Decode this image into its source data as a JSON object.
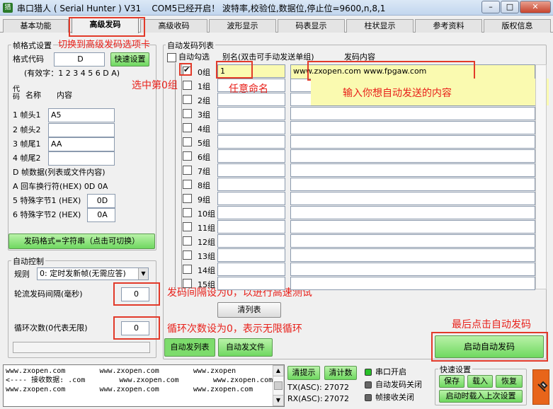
{
  "window": {
    "app_name": "串口猎人",
    "app_name_en": "( Serial Hunter ) V31",
    "status": "COM5已经开启！ 波特率,校验位,数据位,停止位=9600,n,8,1",
    "minimize": "–",
    "maximize": "□",
    "close": "✕"
  },
  "tabs": [
    "基本功能",
    "高级发码",
    "高级收码",
    "波形显示",
    "码表显示",
    "柱状显示",
    "参考资料",
    "版权信息"
  ],
  "frame_settings": {
    "title": "帧格式设置",
    "format_code_label": "格式代码",
    "format_code_value": "D",
    "quick_set_button": "快速设置",
    "valid_chars": "(有效字：1 2 3 4 5 6 D A)",
    "col_code": "代\n码",
    "col_name": "名称",
    "col_content": "内容",
    "rows": [
      {
        "label": "1 帧头1",
        "value": "A5"
      },
      {
        "label": "2 帧头2",
        "value": ""
      },
      {
        "label": "3 帧尾1",
        "value": "AA"
      },
      {
        "label": "4 帧尾2",
        "value": ""
      }
    ],
    "d_row": "D 帧数据(列表或文件内容)",
    "a_row": "A 回车换行符(HEX) 0D 0A",
    "special1_label": "5 特殊字节1 (HEX)",
    "special1_value": "0D",
    "special2_label": "6 特殊字节2 (HEX)",
    "special2_value": "0A",
    "send_format_button": "发码格式=字符串（点击可切换）"
  },
  "auto_control": {
    "title": "自动控制",
    "rule_label": "规则",
    "rule_value": "0: 定时发新帧(无需应答)",
    "interval_label": "轮流发码间隔(毫秒)",
    "interval_value": "0",
    "loop_label": "循环次数(0代表无限)",
    "loop_value": "0"
  },
  "auto_list": {
    "title": "自动发码列表",
    "auto_select_label": "自动勾选",
    "alias_header": "别名(双击可手动发送单组)",
    "content_header": "发码内容",
    "rows": [
      {
        "label": "0组",
        "checked": true,
        "alias": "1",
        "content": "www.zxopen.com        www.fpgaw.com"
      },
      {
        "label": "1组",
        "checked": false,
        "alias": "",
        "content": ""
      },
      {
        "label": "2组",
        "checked": false,
        "alias": "",
        "content": ""
      },
      {
        "label": "3组",
        "checked": false,
        "alias": "",
        "content": ""
      },
      {
        "label": "4组",
        "checked": false,
        "alias": "",
        "content": ""
      },
      {
        "label": "5组",
        "checked": false,
        "alias": "",
        "content": ""
      },
      {
        "label": "6组",
        "checked": false,
        "alias": "",
        "content": ""
      },
      {
        "label": "7组",
        "checked": false,
        "alias": "",
        "content": ""
      },
      {
        "label": "8组",
        "checked": false,
        "alias": "",
        "content": ""
      },
      {
        "label": "9组",
        "checked": false,
        "alias": "",
        "content": ""
      },
      {
        "label": "10组",
        "checked": false,
        "alias": "",
        "content": ""
      },
      {
        "label": "11组",
        "checked": false,
        "alias": "",
        "content": ""
      },
      {
        "label": "12组",
        "checked": false,
        "alias": "",
        "content": ""
      },
      {
        "label": "13组",
        "checked": false,
        "alias": "",
        "content": ""
      },
      {
        "label": "14组",
        "checked": false,
        "alias": "",
        "content": ""
      },
      {
        "label": "15组",
        "checked": false,
        "alias": "",
        "content": ""
      }
    ],
    "clear_button": "清列表",
    "tab_list": "自动发列表",
    "tab_file": "自动发文件",
    "start_button": "启动自动发码"
  },
  "annotations": {
    "switch_tab": "切换到高级发码选项卡",
    "select_group": "选中第0组",
    "name_any": "任意命名",
    "enter_content": "输入你想自动发送的内容",
    "interval_zero": "发码间隔设为0，以进行高速测试",
    "loop_zero": "循环次数设为0，表示无限循环",
    "click_start": "最后点击自动发码"
  },
  "receive": {
    "text": "www.zxopen.com        www.zxopen.com        www.zxopen\n<---- 接收数据: .com        www.zxopen.com        www.zxopen.com\nwww.zxopen.com        www.zxopen.com        www.zxopen.com"
  },
  "status": {
    "clear_display": "清提示",
    "clear_count": "清计数",
    "tx_label": "TX(ASC):",
    "tx_value": "27072",
    "rx_label": "RX(ASC):",
    "rx_value": "27072",
    "port_open": "串口开启",
    "auto_send_off": "自动发码关闭",
    "frame_recv_off": "帧接收关闭"
  },
  "quick_settings": {
    "title": "快速设置",
    "save": "保存",
    "load": "载入",
    "restore": "恢复",
    "startup_load": "启动时载入上次设置"
  },
  "colors": {
    "annotation": "#e23a2a",
    "highlight_yellow": "#fafab0",
    "button_green": "#7ddc6c"
  }
}
